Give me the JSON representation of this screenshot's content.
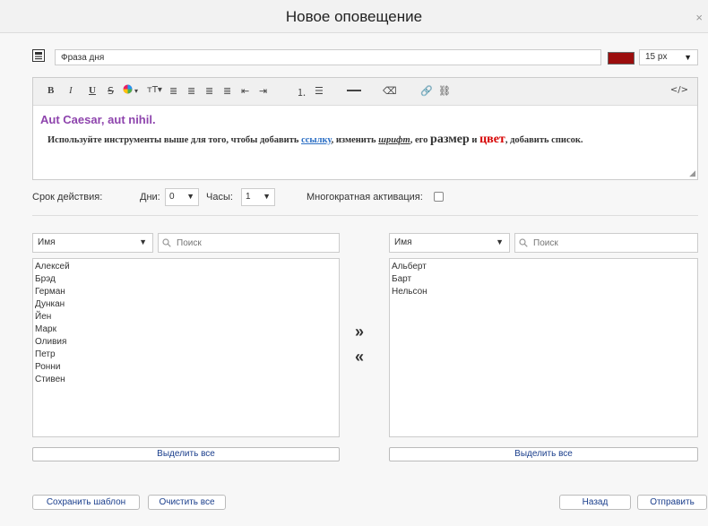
{
  "dialog": {
    "title": "Новое оповещение",
    "close_symbol": "×"
  },
  "subject": {
    "value": "Фраза дня"
  },
  "color": {
    "selected": "#9b0d0d"
  },
  "font_size": {
    "value": "15 px"
  },
  "toolbar": {
    "bold": "B",
    "italic": "I",
    "underline": "U",
    "strike": "S",
    "color_arrow": "▾",
    "textsize": "тT▾",
    "source": "</>"
  },
  "editor": {
    "heading": "Aut Caesar, aut nihil.",
    "t1": "Используйте инструменты выше для того, чтобы добавить ",
    "link": "ссылку",
    "t2": ", изменить ",
    "font": "шрифт",
    "t3": ", его ",
    "size": "размер",
    "t4": " и ",
    "color": "цвет",
    "t5": ", добавить список."
  },
  "duration": {
    "label": "Срок действия:",
    "days_label": "Дни:",
    "days_value": "0",
    "hours_label": "Часы:",
    "hours_value": "1",
    "multi_label": "Многократная активация:"
  },
  "left": {
    "filter": "Имя",
    "search_placeholder": "Поиск",
    "items": [
      "Алексей",
      "Брэд",
      "Герман",
      "Дункан",
      "Йен",
      "Марк",
      "Оливия",
      "Петр",
      "Ронни",
      "Стивен"
    ],
    "select_all": "Выделить все"
  },
  "right": {
    "filter": "Имя",
    "search_placeholder": "Поиск",
    "items": [
      "Альберт",
      "Барт",
      "Нельсон"
    ],
    "select_all": "Выделить все"
  },
  "transfer": {
    "right": "»",
    "left": "«"
  },
  "footer": {
    "save_template": "Сохранить шаблон",
    "clear_all": "Очистить все",
    "back": "Назад",
    "send": "Отправить"
  }
}
